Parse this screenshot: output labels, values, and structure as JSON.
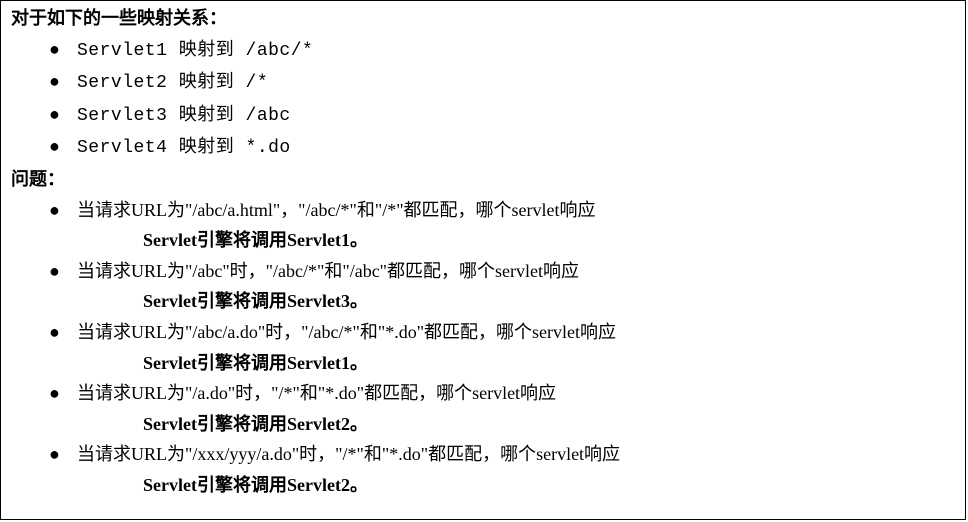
{
  "heading1": "对于如下的一些映射关系：",
  "mappings": [
    {
      "text": "Servlet1 映射到 /abc/*"
    },
    {
      "text": "Servlet2 映射到 /*"
    },
    {
      "text": "Servlet3 映射到 /abc"
    },
    {
      "text": "Servlet4 映射到 *.do"
    }
  ],
  "heading2": "问题：",
  "questions": [
    {
      "q": "当请求URL为\"/abc/a.html\"，\"/abc/*\"和\"/*\"都匹配，哪个servlet响应",
      "a": "Servlet引擎将调用Servlet1。"
    },
    {
      "q": "当请求URL为\"/abc\"时，\"/abc/*\"和\"/abc\"都匹配，哪个servlet响应",
      "a": "Servlet引擎将调用Servlet3。"
    },
    {
      "q": "当请求URL为\"/abc/a.do\"时，\"/abc/*\"和\"*.do\"都匹配，哪个servlet响应",
      "a": "Servlet引擎将调用Servlet1。"
    },
    {
      "q": "当请求URL为\"/a.do\"时，\"/*\"和\"*.do\"都匹配，哪个servlet响应",
      "a": "Servlet引擎将调用Servlet2。"
    },
    {
      "q": "当请求URL为\"/xxx/yyy/a.do\"时，\"/*\"和\"*.do\"都匹配，哪个servlet响应",
      "a": "Servlet引擎将调用Servlet2。"
    }
  ]
}
